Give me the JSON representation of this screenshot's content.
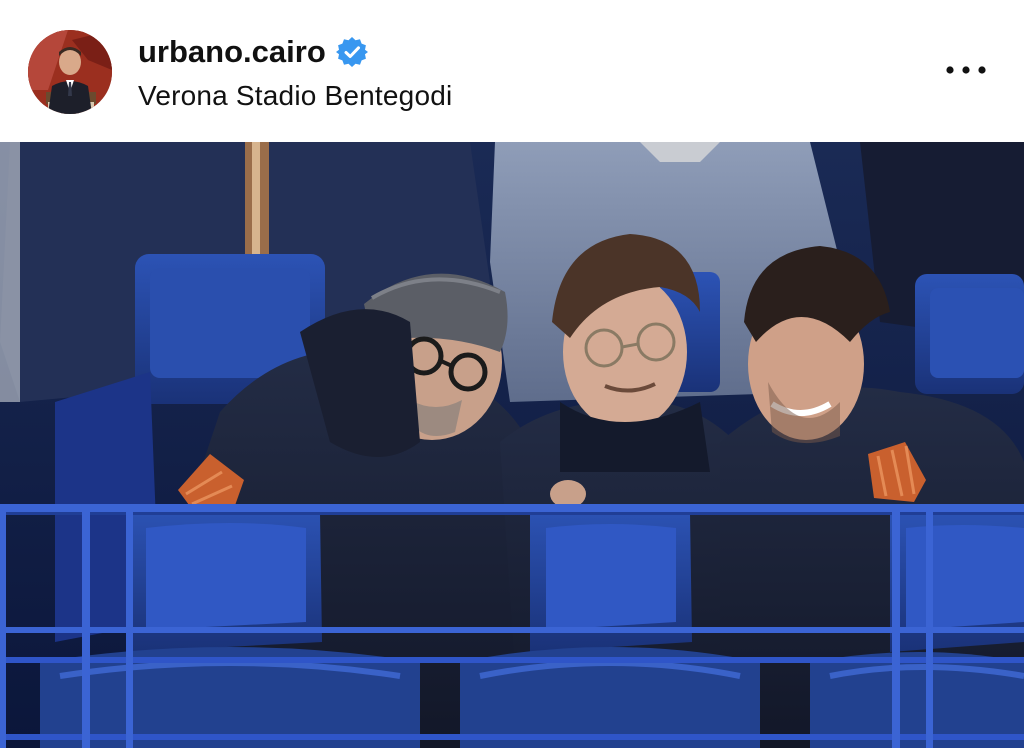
{
  "post": {
    "username": "urbano.cairo",
    "verified": true,
    "location": "Verona Stadio Bentegodi",
    "avatar_icon": "profile-avatar",
    "more_icon": "more-options-icon",
    "verified_icon": "verified-badge-icon"
  },
  "colors": {
    "verified_blue": "#3897f0",
    "seat_blue": "#1f3f92",
    "rail_blue": "#2f55c8",
    "armband_orange": "#c9602e"
  }
}
